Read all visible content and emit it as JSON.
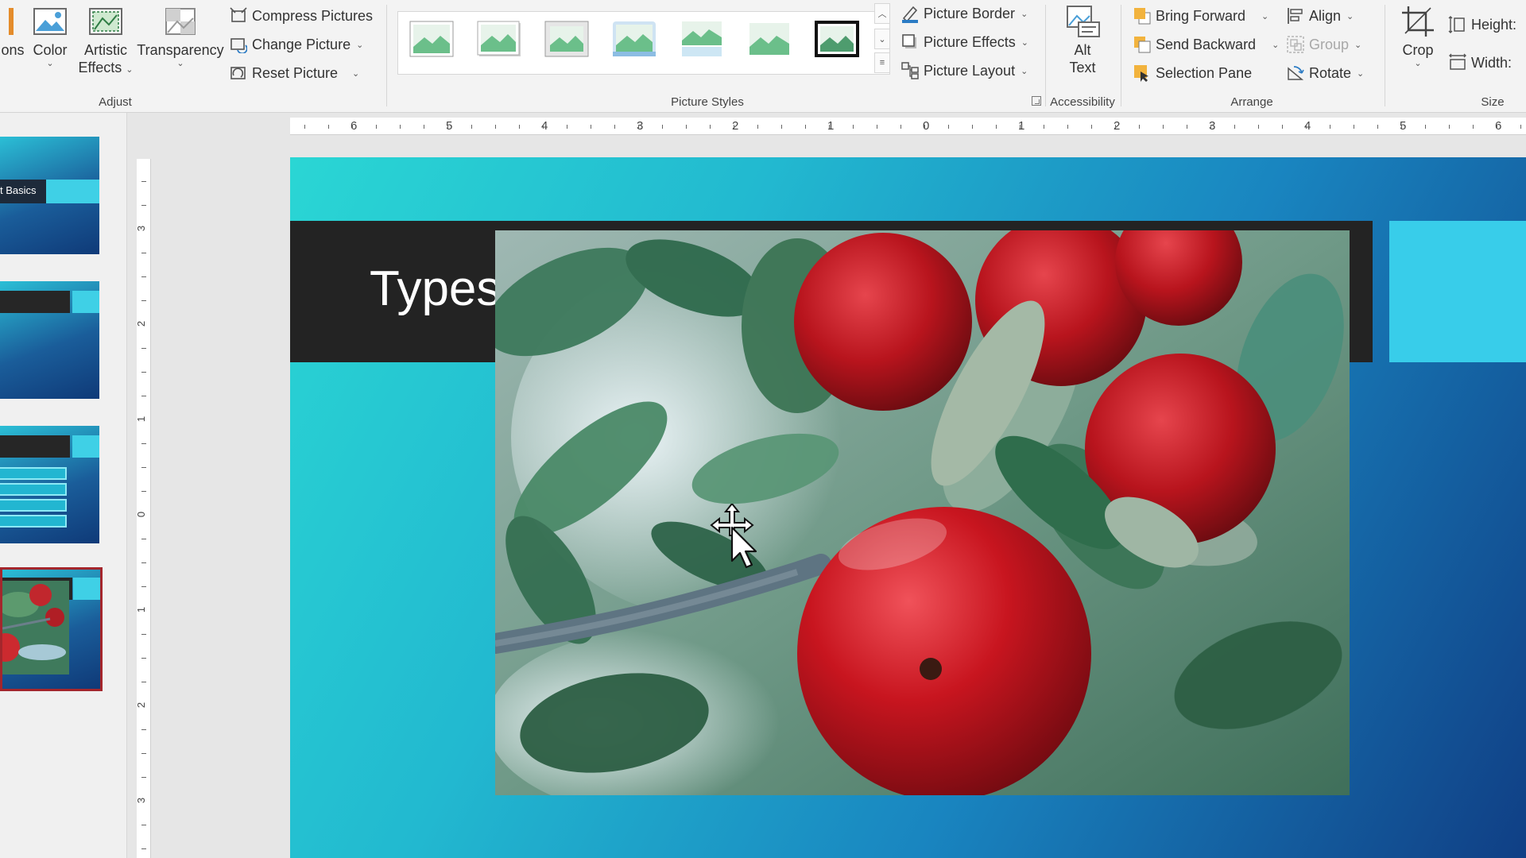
{
  "ribbon": {
    "adjust": {
      "label": "Adjust",
      "corrections_partial": "ons",
      "color": "Color",
      "artistic_effects_line1": "Artistic",
      "artistic_effects_line2": "Effects",
      "transparency": "Transparency",
      "compress": "Compress Pictures",
      "change": "Change Picture",
      "reset": "Reset Picture"
    },
    "picture_styles": {
      "label": "Picture Styles",
      "border": "Picture Border",
      "effects": "Picture Effects",
      "layout": "Picture Layout"
    },
    "accessibility": {
      "label": "Accessibility",
      "alt_text_line1": "Alt",
      "alt_text_line2": "Text"
    },
    "arrange": {
      "label": "Arrange",
      "bring_forward": "Bring Forward",
      "send_backward": "Send Backward",
      "selection_pane": "Selection Pane",
      "align": "Align",
      "group": "Group",
      "rotate": "Rotate"
    },
    "size": {
      "label": "Size",
      "crop": "Crop",
      "height": "Height:",
      "width": "Width:"
    }
  },
  "thumbnails": {
    "slide1_title_partial": "t Basics"
  },
  "slide": {
    "title": "Types"
  },
  "rulers": {
    "horizontal": [
      "6",
      "5",
      "4",
      "3",
      "2",
      "1",
      "0",
      "1",
      "2",
      "3",
      "4",
      "5",
      "6"
    ],
    "vertical": [
      "3",
      "2",
      "1",
      "0",
      "1",
      "2",
      "3"
    ]
  },
  "colors": {
    "slide_gradient_start": "#2ad6d4",
    "slide_gradient_end": "#103f85",
    "title_band": "#232323",
    "accent": "#38cdea",
    "selected_thumb_border": "#a4262c"
  }
}
